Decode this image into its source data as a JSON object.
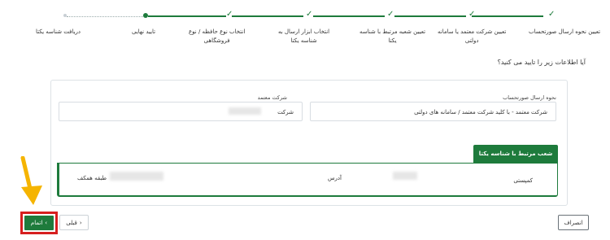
{
  "stepper": {
    "steps": [
      {
        "label_line1": "تعیین نحوه ارسال صورتحساب",
        "label_line2": "",
        "state": "done"
      },
      {
        "label_line1": "تعیین شرکت معتمد یا سامانه",
        "label_line2": "دولتی",
        "state": "done"
      },
      {
        "label_line1": "تعیین شعبه مرتبط با شناسه",
        "label_line2": "یکتا",
        "state": "done"
      },
      {
        "label_line1": "انتخاب ابزار ارسال به",
        "label_line2": "شناسه یکتا",
        "state": "done"
      },
      {
        "label_line1": "انتخاب نوع حافظه / نوع",
        "label_line2": "فروشگاهی",
        "state": "done"
      },
      {
        "label_line1": "تایید نهایی",
        "label_line2": "",
        "state": "current"
      },
      {
        "label_line1": "دریافت شناسه یکتا",
        "label_line2": "",
        "state": "pending"
      }
    ],
    "check_glyph": "✓"
  },
  "question": "آیا اطلاعات زیر را تایید می کنید؟",
  "fields": {
    "sending_method_label": "نحوه ارسال صورتحساب",
    "sending_method_value": "شرکت معتمد - با کلید شرکت معتمد / سامانه های دولتی",
    "trusted_company_label": "شرکت معتمد",
    "trusted_company_value": "شرکت"
  },
  "branch": {
    "title": "شعب مرتبط با شناسه یکتا",
    "name_value": "کمپستی",
    "address_label": "آدرس",
    "address_value": "طبقه همکف"
  },
  "buttons": {
    "finish": "اتمام",
    "finish_icon": "‹",
    "prev": "قبلی",
    "prev_icon": "›",
    "cancel": "انصراف"
  },
  "colors": {
    "primary_green": "#1e7b3c",
    "highlight_red": "#d61f1f",
    "arrow_orange": "#f5b400"
  }
}
